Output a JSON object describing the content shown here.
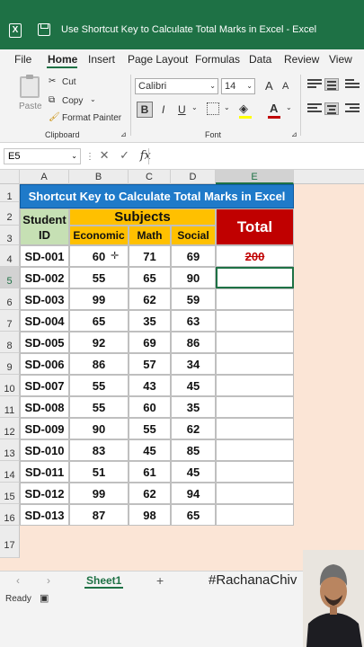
{
  "window": {
    "title": "Use Shortcut Key to Calculate Total Marks in Excel  -  Excel",
    "logo": "X"
  },
  "menu": [
    "File",
    "Home",
    "Insert",
    "Page Layout",
    "Formulas",
    "Data",
    "Review",
    "View"
  ],
  "ribbon": {
    "paste": "Paste",
    "cut": "Cut",
    "copy": "Copy",
    "format_painter": "Format Painter",
    "clipboard_group": "Clipboard",
    "font_name": "Calibri",
    "font_size": "14",
    "font_group": "Font",
    "grow_font": "A",
    "shrink_font": "A",
    "bold": "B",
    "italic": "I",
    "underline": "U",
    "font_color": "A"
  },
  "formula_bar": {
    "name_box": "E5",
    "fx": "fx",
    "cancel": "✕",
    "enter": "✓"
  },
  "columns": [
    "A",
    "B",
    "C",
    "D",
    "E"
  ],
  "rows": [
    "1",
    "2",
    "3",
    "4",
    "5",
    "6",
    "7",
    "8",
    "9",
    "10",
    "11",
    "12",
    "13",
    "14",
    "15",
    "16",
    "17"
  ],
  "table": {
    "title": "Shortcut Key to Calculate Total Marks in Excel",
    "student_id": "Student ID",
    "subjects": "Subjects",
    "headers": [
      "Economic",
      "Math",
      "Social"
    ],
    "total": "Total",
    "data": [
      {
        "id": "SD-001",
        "economic": "60",
        "math": "71",
        "social": "69",
        "total": "200"
      },
      {
        "id": "SD-002",
        "economic": "55",
        "math": "65",
        "social": "90",
        "total": ""
      },
      {
        "id": "SD-003",
        "economic": "99",
        "math": "62",
        "social": "59",
        "total": ""
      },
      {
        "id": "SD-004",
        "economic": "65",
        "math": "35",
        "social": "63",
        "total": ""
      },
      {
        "id": "SD-005",
        "economic": "92",
        "math": "69",
        "social": "86",
        "total": ""
      },
      {
        "id": "SD-006",
        "economic": "86",
        "math": "57",
        "social": "34",
        "total": ""
      },
      {
        "id": "SD-007",
        "economic": "55",
        "math": "43",
        "social": "45",
        "total": ""
      },
      {
        "id": "SD-008",
        "economic": "55",
        "math": "60",
        "social": "35",
        "total": ""
      },
      {
        "id": "SD-009",
        "economic": "90",
        "math": "55",
        "social": "62",
        "total": ""
      },
      {
        "id": "SD-010",
        "economic": "83",
        "math": "45",
        "social": "85",
        "total": ""
      },
      {
        "id": "SD-011",
        "economic": "51",
        "math": "61",
        "social": "45",
        "total": ""
      },
      {
        "id": "SD-012",
        "economic": "99",
        "math": "62",
        "social": "94",
        "total": ""
      },
      {
        "id": "SD-013",
        "economic": "87",
        "math": "98",
        "social": "65",
        "total": ""
      }
    ]
  },
  "sheet_tab": "Sheet1",
  "add_sheet": "+",
  "watermark": "#RachanaChiv",
  "status": "Ready",
  "colors": {
    "excel_green": "#1e7145",
    "title_blue": "#1f7ac9",
    "subjects_yellow": "#ffc000",
    "total_red": "#c00000",
    "student_green": "#c6e0b4",
    "sheet_bg": "#fbe5d6"
  }
}
